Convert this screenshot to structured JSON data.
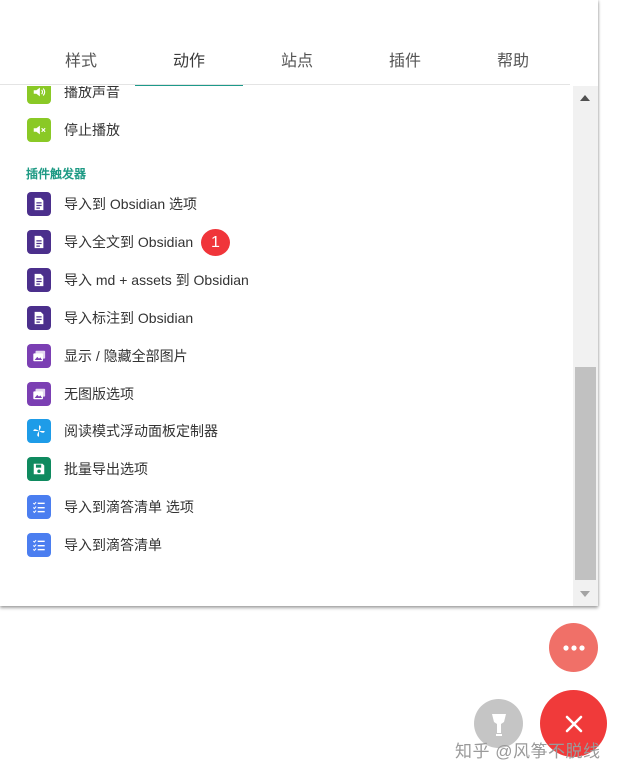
{
  "tabs": [
    "样式",
    "动作",
    "站点",
    "插件",
    "帮助"
  ],
  "active_tab": "动作",
  "items_top": [
    {
      "label": "播放声音",
      "icon": "volume-up-icon",
      "color": "#8ac926"
    },
    {
      "label": "停止播放",
      "icon": "volume-mute-icon",
      "color": "#8ac926"
    }
  ],
  "section_plugin_triggers": "插件触发器",
  "items_plugin": [
    {
      "label": "导入到 Obsidian 选项",
      "icon": "document-icon",
      "color": "#4b2f8c"
    },
    {
      "label": "导入全文到 Obsidian",
      "icon": "document-icon",
      "color": "#4b2f8c",
      "badge": "1"
    },
    {
      "label": "导入 md + assets 到 Obsidian",
      "icon": "document-icon",
      "color": "#4b2f8c"
    },
    {
      "label": "导入标注到 Obsidian",
      "icon": "document-icon",
      "color": "#4b2f8c"
    },
    {
      "label": "显示 / 隐藏全部图片",
      "icon": "images-icon",
      "color": "#7b3fb3"
    },
    {
      "label": "无图版选项",
      "icon": "images-icon",
      "color": "#7b3fb3"
    },
    {
      "label": "阅读模式浮动面板定制器",
      "icon": "pinwheel-icon",
      "color": "#1e9ce8"
    },
    {
      "label": "批量导出选项",
      "icon": "save-icon",
      "color": "#0f8a5f"
    },
    {
      "label": "导入到滴答清单 选项",
      "icon": "checklist-icon",
      "color": "#4b7ef0"
    },
    {
      "label": "导入到滴答清单",
      "icon": "checklist-icon",
      "color": "#4b7ef0"
    }
  ],
  "fabs": {
    "more": {
      "icon": "more-dots-icon",
      "color": "#f07068"
    },
    "close": {
      "icon": "close-icon",
      "color": "#f03a3a"
    },
    "lamp": {
      "icon": "lamp-icon",
      "color": "#c5c5c5"
    }
  },
  "watermark": "知乎 @风筝不脱线"
}
